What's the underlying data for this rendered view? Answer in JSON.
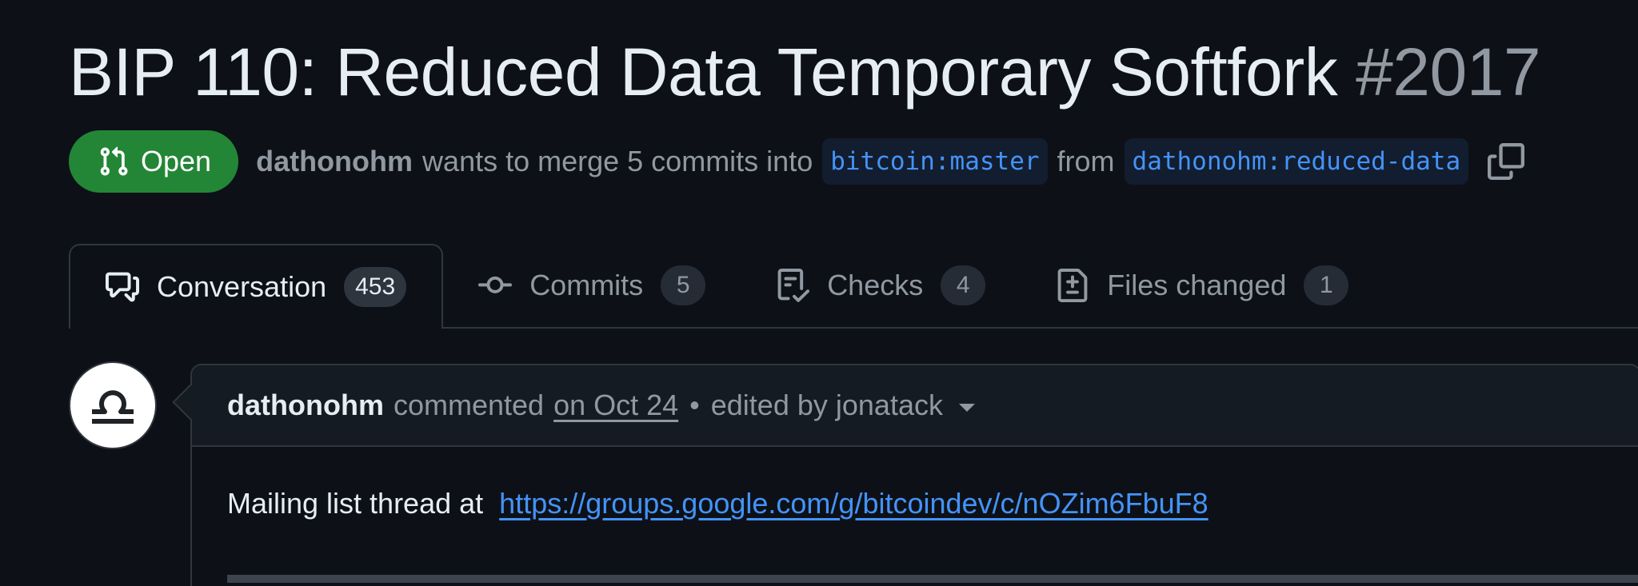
{
  "pr": {
    "title": "BIP 110: Reduced Data Temporary Softfork",
    "number": "#2017",
    "state": "Open",
    "author": "dathonohm",
    "merge_text": "wants to merge 5 commits into",
    "base_branch": "bitcoin:master",
    "from_text": "from",
    "head_branch": "dathonohm:reduced-data"
  },
  "tabs": [
    {
      "label": "Conversation",
      "count": "453",
      "icon": "comment-discussion-icon"
    },
    {
      "label": "Commits",
      "count": "5",
      "icon": "git-commit-icon"
    },
    {
      "label": "Checks",
      "count": "4",
      "icon": "checklist-icon"
    },
    {
      "label": "Files changed",
      "count": "1",
      "icon": "file-diff-icon"
    }
  ],
  "comment": {
    "author": "dathonohm",
    "verb": "commented",
    "date": "on Oct 24",
    "separator": "•",
    "edited_by": "edited by jonatack",
    "body_text": "Mailing list thread at",
    "link": "https://groups.google.com/g/bitcoindev/c/nOZim6FbuF8"
  },
  "colors": {
    "background": "#0d1117",
    "open_green": "#238636",
    "link_blue": "#4493f8",
    "muted": "#9198a1",
    "border": "#30363d"
  }
}
